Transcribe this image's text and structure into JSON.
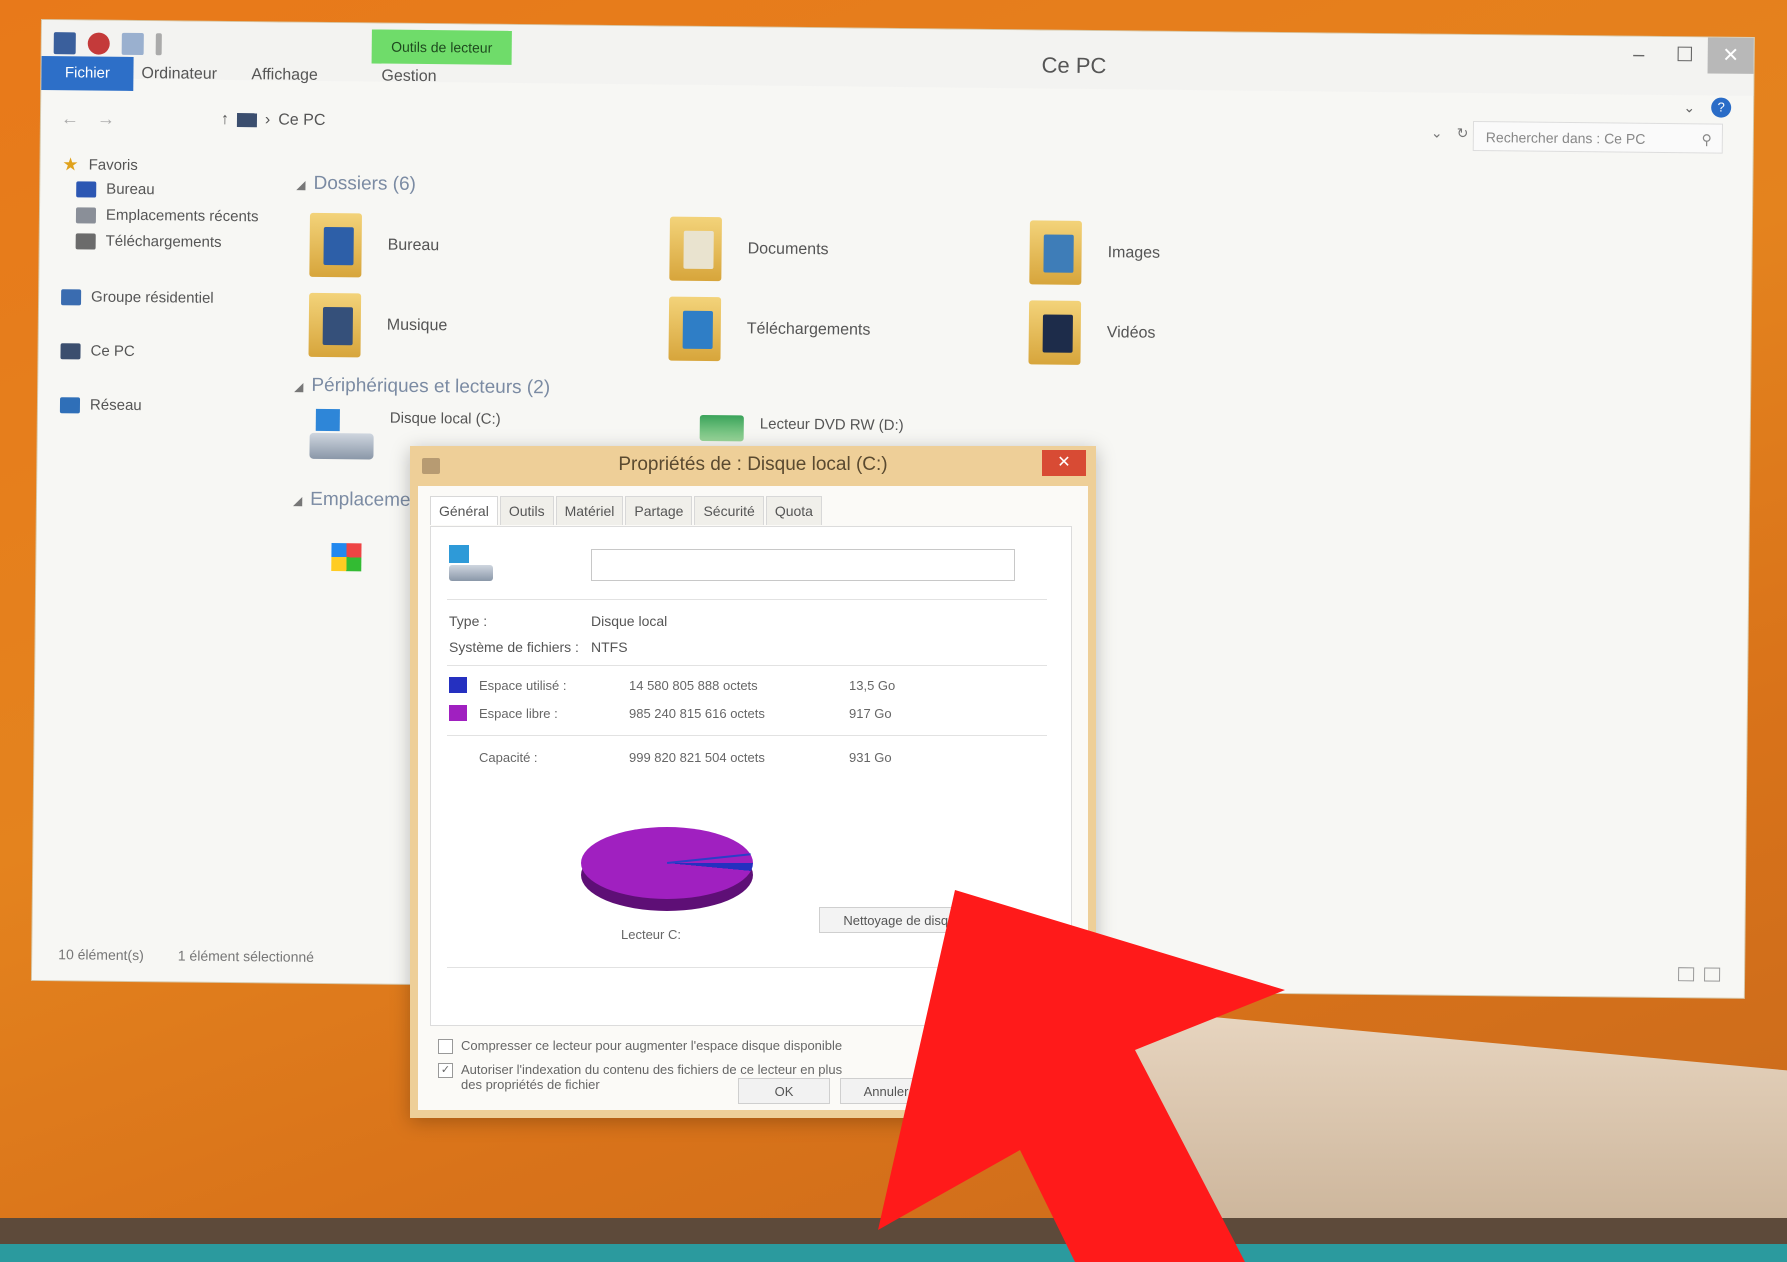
{
  "explorer": {
    "title": "Ce PC",
    "tools_tab": "Outils de lecteur",
    "ribbon_tabs": [
      "Fichier",
      "Ordinateur",
      "Affichage",
      "Gestion"
    ],
    "address": "Ce PC",
    "search_placeholder": "Rechercher dans : Ce PC",
    "nav": {
      "favorites": "Favoris",
      "items": [
        "Bureau",
        "Emplacements récents",
        "Téléchargements"
      ],
      "homegroup": "Groupe résidentiel",
      "this_pc": "Ce PC",
      "network": "Réseau"
    },
    "groups": {
      "folders": "Dossiers (6)",
      "devices": "Périphériques et lecteurs (2)",
      "locations": "Emplacements réseau"
    },
    "folders": [
      "Bureau",
      "Documents",
      "Images",
      "Musique",
      "Téléchargements",
      "Vidéos"
    ],
    "drives": [
      "Disque local (C:)",
      "Lecteur DVD RW (D:)"
    ],
    "status": {
      "count": "10 élément(s)",
      "selected": "1 élément sélectionné"
    }
  },
  "dialog": {
    "title": "Propriétés de : Disque local (C:)",
    "tabs": [
      "Général",
      "Outils",
      "Matériel",
      "Partage",
      "Sécurité",
      "Quota"
    ],
    "type_label": "Type :",
    "type_value": "Disque local",
    "fs_label": "Système de fichiers :",
    "fs_value": "NTFS",
    "used": {
      "label": "Espace utilisé :",
      "bytes": "14 580 805 888 octets",
      "size": "13,5 Go",
      "color": "#2530c0"
    },
    "free": {
      "label": "Espace libre :",
      "bytes": "985 240 815 616 octets",
      "size": "917 Go",
      "color": "#a020c0"
    },
    "capacity": {
      "label": "Capacité :",
      "bytes": "999 820 821 504 octets",
      "size": "931 Go"
    },
    "drive_caption": "Lecteur C:",
    "cleanup_button": "Nettoyage de disque",
    "compress_label": "Compresser ce lecteur pour augmenter l'espace disque disponible",
    "index_label": "Autoriser l'indexation du contenu des fichiers de ce lecteur en plus des propriétés de fichier",
    "ok": "OK",
    "cancel": "Annuler",
    "used_fraction": 0.015
  }
}
